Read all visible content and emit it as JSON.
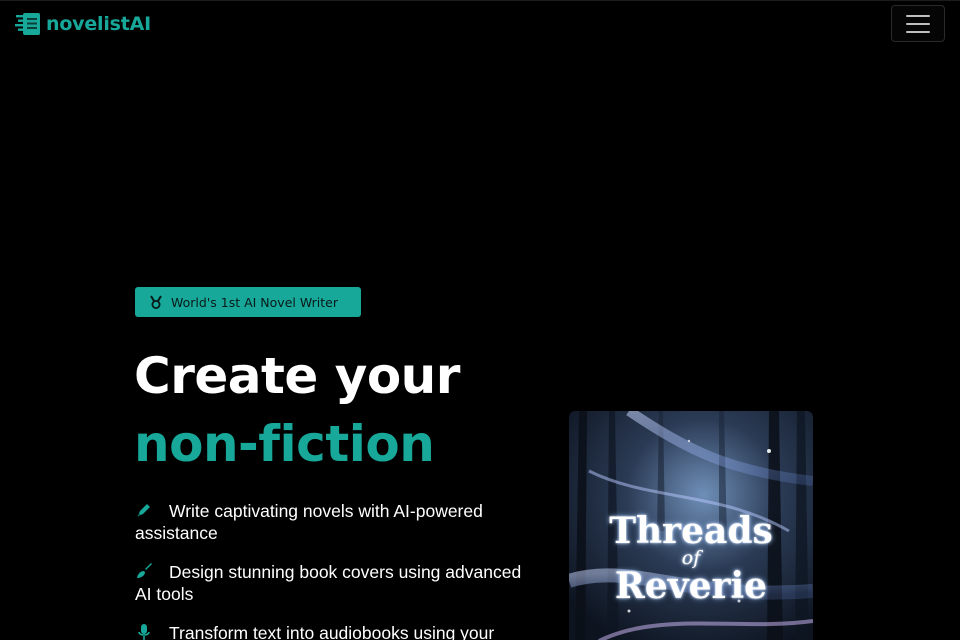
{
  "header": {
    "brand": "novelistAI",
    "brand_icon": "logo-stripes-icon",
    "menu_icon": "hamburger-icon",
    "accent_color": "#17a89a"
  },
  "hero": {
    "badge": {
      "icon": "medal-icon",
      "text": "World's 1st AI Novel Writer"
    },
    "headline_line1": "Create your",
    "headline_line2": "non-fiction",
    "features": [
      {
        "icon": "pen-icon",
        "text": "Write captivating novels with AI-powered assistance"
      },
      {
        "icon": "paintbrush-icon",
        "text": "Design stunning book covers using advanced AI tools"
      },
      {
        "icon": "microphone-icon",
        "text": "Transform text into audiobooks using your"
      }
    ]
  },
  "book_cover": {
    "title_line1": "Threads",
    "title_line2": "of",
    "title_line3": "Reverie"
  }
}
